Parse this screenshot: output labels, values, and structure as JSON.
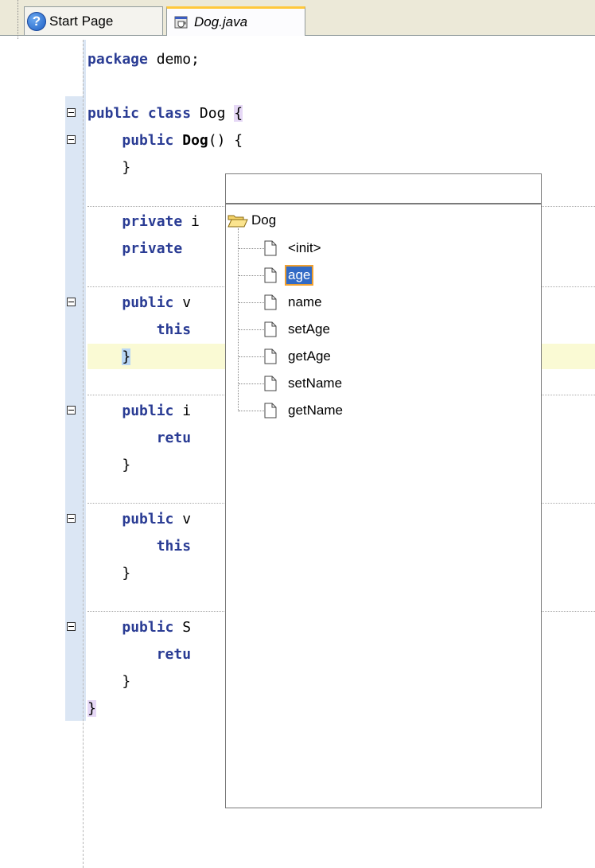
{
  "tabs": [
    {
      "label": "Start Page",
      "icon": "help-icon",
      "active": false
    },
    {
      "label": "Dog.java",
      "icon": "java-file-icon",
      "active": true
    }
  ],
  "code": {
    "line1": {
      "kw": "package",
      "rest": " demo;"
    },
    "line2": {
      "kw1": "public",
      "kw2": "class",
      "rest": " Dog ",
      "brace": "{"
    },
    "line3": {
      "kw": "public",
      "name": "Dog",
      "rest": "() {"
    },
    "line4": "}",
    "line5": {
      "kw": "private",
      "rest": " i"
    },
    "line6": {
      "kw": "private"
    },
    "line7": {
      "kw": "public",
      "rest": " v"
    },
    "line8": {
      "kw": "this"
    },
    "line9": "}",
    "line10": {
      "kw": "public",
      "rest": " i"
    },
    "line11": {
      "kw": "retu"
    },
    "line12": "}",
    "line13": {
      "kw": "public",
      "rest": " v"
    },
    "line14": {
      "kw": "this"
    },
    "line15": "}",
    "line16": {
      "kw": "public",
      "rest": " S"
    },
    "line17": {
      "kw": "retu"
    },
    "line18": "}",
    "line19": "}"
  },
  "popup": {
    "search_value": "",
    "root_label": "Dog",
    "members": [
      "<init>",
      "age",
      "name",
      "setAge",
      "getAge",
      "setName",
      "getName"
    ],
    "selected": "age"
  }
}
